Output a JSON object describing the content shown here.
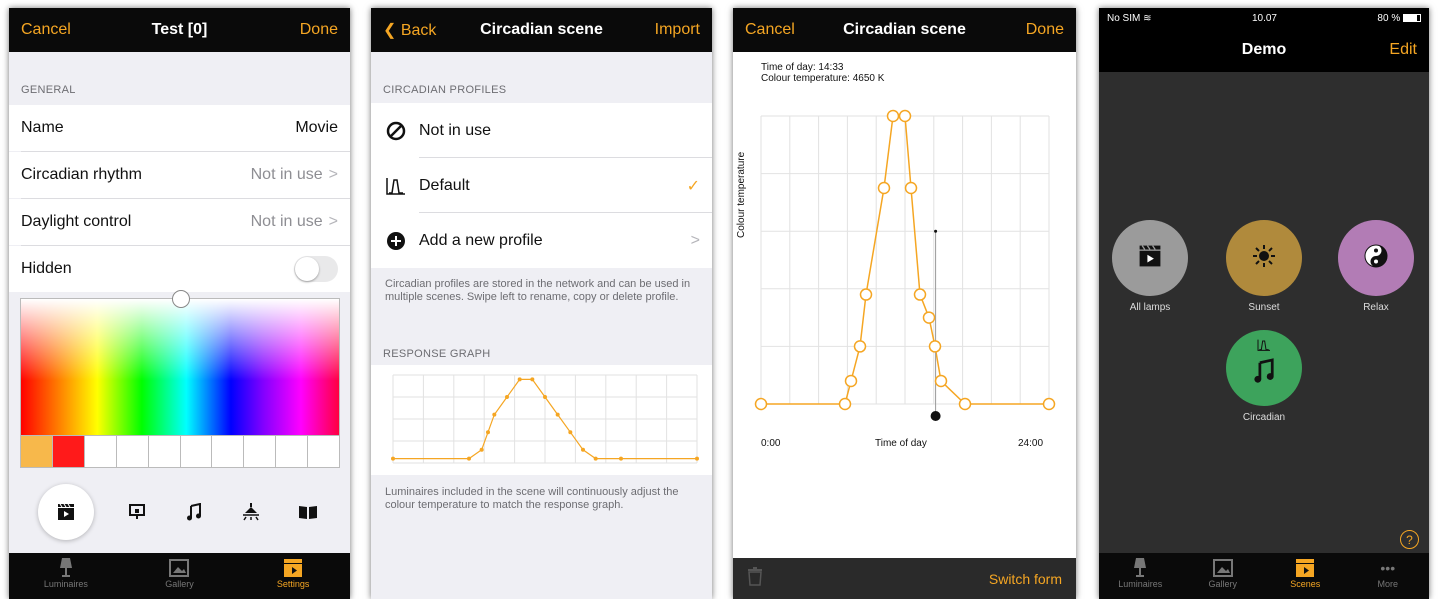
{
  "colors": {
    "accent": "#f5a623",
    "nav_background": "#0a0a0a",
    "graph_line": "#f5a623",
    "scene_all_lamps": "#9b9b9b",
    "scene_sunset": "#b08a3c",
    "scene_relax": "#b27cb5",
    "scene_circadian": "#3da35c",
    "swatch_selected": "#f7b84b",
    "swatch_red": "#ff1a1a"
  },
  "panel1": {
    "nav": {
      "cancel": "Cancel",
      "title": "Test [0]",
      "done": "Done"
    },
    "section_general": "GENERAL",
    "rows": {
      "name": {
        "label": "Name",
        "value": "Movie"
      },
      "circadian": {
        "label": "Circadian rhythm",
        "value": "Not in use",
        "chevron": ">"
      },
      "daylight": {
        "label": "Daylight control",
        "value": "Not in use",
        "chevron": ">"
      },
      "hidden": {
        "label": "Hidden",
        "toggle_on": false
      }
    },
    "icon_picker": {
      "selected_index": 0,
      "icons": [
        "clapperboard-icon",
        "projector-screen-icon",
        "music-note-icon",
        "pendant-lamp-icon",
        "book-icon"
      ]
    },
    "tabbar": {
      "tabs": [
        {
          "label": "Luminaires",
          "icon": "lamp-icon",
          "active": false
        },
        {
          "label": "Gallery",
          "icon": "picture-icon",
          "active": false
        },
        {
          "label": "Settings",
          "icon": "clapperboard-icon",
          "active": true
        }
      ]
    }
  },
  "panel2": {
    "nav": {
      "back": "Back",
      "back_icon": "chevron-left-icon",
      "title": "Circadian scene",
      "import": "Import"
    },
    "section_profiles": "CIRCADIAN PROFILES",
    "profiles": [
      {
        "label": "Not in use",
        "icon": "prohibited-icon",
        "tail": ""
      },
      {
        "label": "Default",
        "icon": "curve-icon",
        "tail": "✓"
      },
      {
        "label": "Add a new profile",
        "icon": "plus-circle-icon",
        "tail": ">"
      }
    ],
    "profiles_note": "Circadian profiles are stored in the network and can be used in multiple scenes. Swipe left to rename, copy or delete profile.",
    "section_graph": "RESPONSE GRAPH",
    "graph_note": "Luminaires included in the scene will continuously adjust the colour temperature to match the response graph."
  },
  "panel3": {
    "nav": {
      "cancel": "Cancel",
      "title": "Circadian scene",
      "done": "Done"
    },
    "readout_time": "Time of day: 14:33",
    "readout_temp": "Colour temperature: 4650 K",
    "y_axis_label": "Colour temperature",
    "x_axis_label": "Time of day",
    "x_start": "0:00",
    "x_end": "24:00",
    "footer": {
      "trash_icon": "trash-icon",
      "switch_form": "Switch form"
    }
  },
  "panel4": {
    "status": {
      "carrier": "No SIM",
      "wifi_icon": "wifi-icon",
      "time": "10.07",
      "battery": "80 %",
      "battery_icon": "battery-icon"
    },
    "nav": {
      "title": "Demo",
      "edit": "Edit"
    },
    "scenes": [
      {
        "label": "All lamps",
        "icon": "clapperboard-icon"
      },
      {
        "label": "Sunset",
        "icon": "sun-icon"
      },
      {
        "label": "Relax",
        "icon": "yin-yang-icon"
      },
      {
        "label": "Circadian",
        "icon": "music-note-icon",
        "badge_icon": "curve-icon"
      }
    ],
    "help_icon": "?",
    "tabbar": {
      "tabs": [
        {
          "label": "Luminaires",
          "icon": "lamp-icon",
          "active": false
        },
        {
          "label": "Gallery",
          "icon": "picture-icon",
          "active": false
        },
        {
          "label": "Scenes",
          "icon": "clapperboard-icon",
          "active": true
        },
        {
          "label": "More",
          "icon": "more-dots-icon",
          "active": false
        }
      ]
    }
  },
  "chart_data": [
    {
      "type": "line",
      "x": [
        0,
        6,
        7,
        7.5,
        8,
        9,
        10,
        11,
        12,
        13,
        14,
        15,
        16,
        18,
        24
      ],
      "series": [
        {
          "values": [
            5,
            5,
            15,
            35,
            55,
            75,
            95,
            95,
            75,
            55,
            35,
            15,
            5,
            5,
            5
          ]
        }
      ],
      "xlim": [
        0,
        24
      ],
      "ylim": [
        0,
        100
      ],
      "grid": true
    },
    {
      "type": "line",
      "x": [
        0,
        7,
        7.5,
        8.25,
        8.75,
        10.25,
        11,
        12,
        12.5,
        13.25,
        14,
        14.5,
        15,
        17,
        24
      ],
      "series": [
        {
          "values": [
            0,
            0,
            8,
            20,
            38,
            75,
            100,
            100,
            75,
            38,
            30,
            20,
            8,
            0,
            0
          ]
        }
      ],
      "xlim": [
        0,
        24
      ],
      "ylim": [
        0,
        100
      ],
      "grid": true,
      "marker": {
        "x": 14.55,
        "y": 60,
        "show_vertical_line": true
      }
    }
  ]
}
